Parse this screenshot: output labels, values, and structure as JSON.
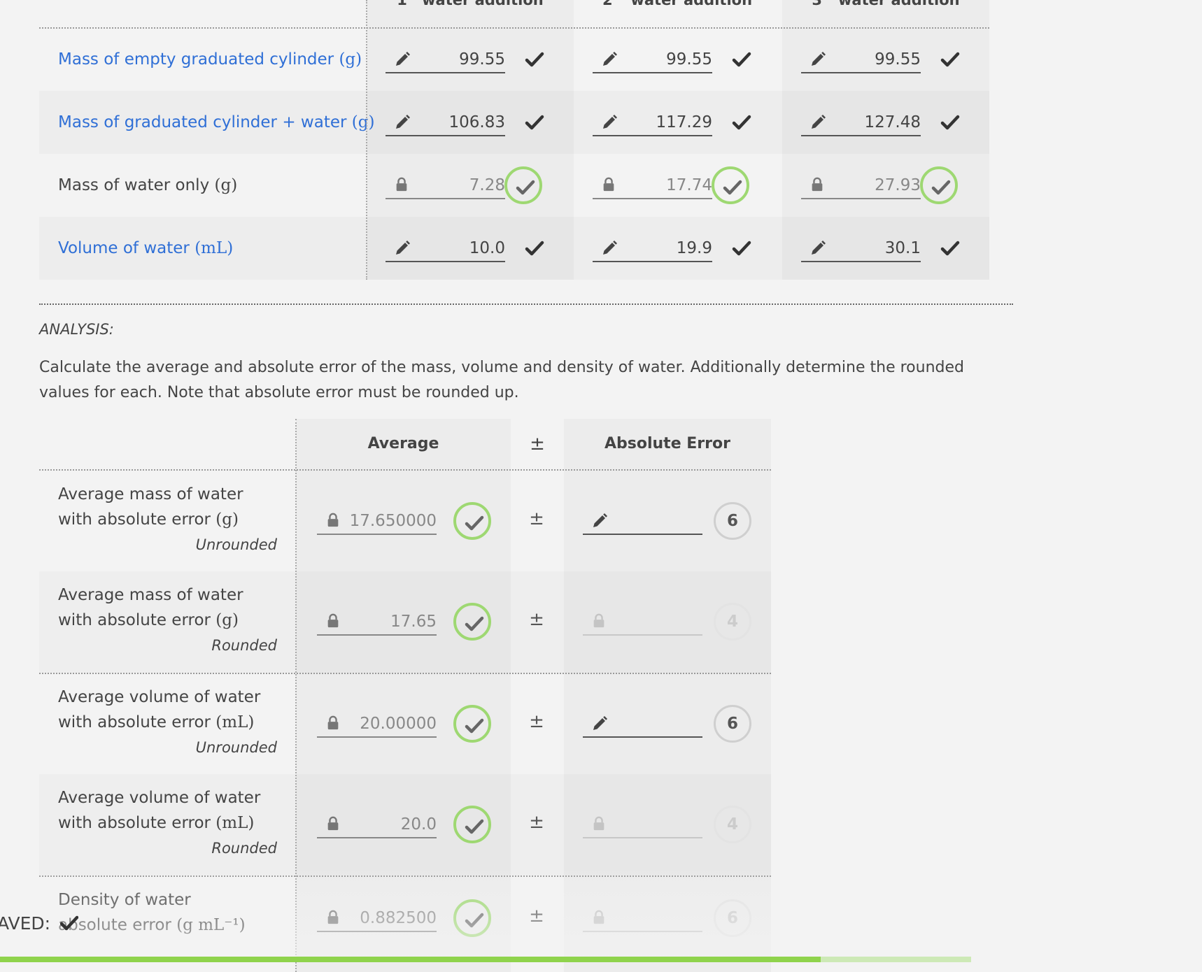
{
  "data_table": {
    "columns": [
      {
        "ordinal": "1",
        "suffix": "st",
        "label": "water addition"
      },
      {
        "ordinal": "2",
        "suffix": "nd",
        "label": "water addition"
      },
      {
        "ordinal": "3",
        "suffix": "rd",
        "label": "water addition"
      }
    ],
    "rows": [
      {
        "label": "Mass of empty graduated cylinder",
        "unit": "(g)",
        "editable": true,
        "values": [
          "99.55",
          "99.55",
          "99.55"
        ]
      },
      {
        "label": "Mass of graduated cylinder + water",
        "unit": "(g)",
        "editable": true,
        "values": [
          "106.83",
          "117.29",
          "127.48"
        ]
      },
      {
        "label": "Mass of water only",
        "unit": "(g)",
        "editable": false,
        "values": [
          "7.28",
          "17.74",
          "27.93"
        ]
      },
      {
        "label": "Volume of water",
        "unit": "(mL)",
        "editable": true,
        "values": [
          "10.0",
          "19.9",
          "30.1"
        ]
      }
    ]
  },
  "analysis": {
    "title": "ANALYSIS:",
    "instructions": "Calculate the average and absolute error of the mass, volume and density of water. Additionally determine the rounded values for each. Note that absolute error must be rounded up.",
    "headers": {
      "average": "Average",
      "pm": "±",
      "abs_error": "Absolute Error"
    },
    "rows": [
      {
        "line1": "Average mass of water",
        "line2": "with absolute error",
        "unit": "(g)",
        "mode": "Unrounded",
        "average": "17.650000",
        "error_value": "",
        "error_editable": true,
        "attempts": "6"
      },
      {
        "line1": "Average mass of water",
        "line2": "with absolute error",
        "unit": "(g)",
        "mode": "Rounded",
        "average": "17.65",
        "error_value": "",
        "error_editable": false,
        "attempts": "4"
      },
      {
        "line1": "Average volume of water",
        "line2": "with absolute error",
        "unit": "(mL)",
        "mode": "Unrounded",
        "average": "20.00000",
        "error_value": "",
        "error_editable": true,
        "attempts": "6"
      },
      {
        "line1": "Average volume of water",
        "line2": "with absolute error",
        "unit": "(mL)",
        "mode": "Rounded",
        "average": "20.0",
        "error_value": "",
        "error_editable": false,
        "attempts": "4"
      },
      {
        "line1": "Density of water",
        "line2": "absolute error",
        "unit": "(g mL⁻¹)",
        "mode": "",
        "average": "0.882500",
        "error_value": "",
        "error_editable": false,
        "attempts": "6"
      }
    ]
  },
  "status": {
    "saved_label": "AVED:",
    "progress_fraction": 0.845
  },
  "colors": {
    "link": "#2f6fd6",
    "success_ring": "#9ed872",
    "progress": "#8fd34c",
    "progress_track": "#cde9b6"
  },
  "icons": {
    "edit": "pencil-icon",
    "locked": "lock-icon",
    "valid": "check-icon"
  }
}
